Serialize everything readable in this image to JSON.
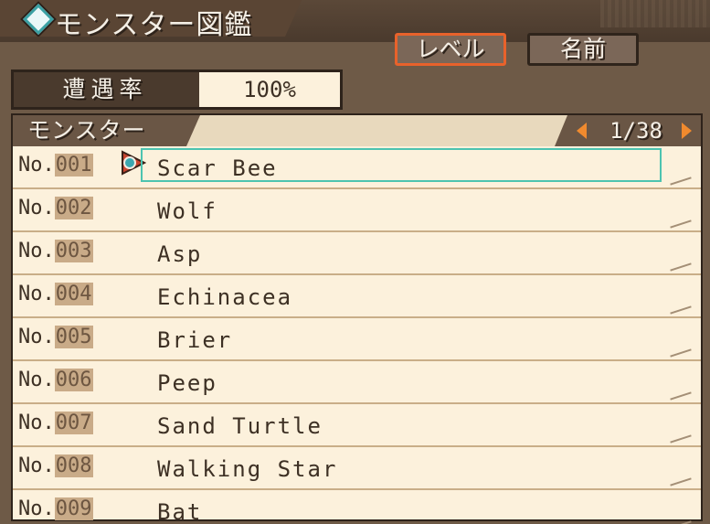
{
  "title": "モンスター図鑑",
  "sort_buttons": {
    "level": "レベル",
    "name": "名前"
  },
  "encounter": {
    "label": "遭遇率",
    "value": "100%"
  },
  "list_header": "モンスター",
  "pager": {
    "current": "1/38"
  },
  "monsters": [
    {
      "no_prefix": "No.",
      "no": "001",
      "name": "Scar Bee"
    },
    {
      "no_prefix": "No.",
      "no": "002",
      "name": "Wolf"
    },
    {
      "no_prefix": "No.",
      "no": "003",
      "name": "Asp"
    },
    {
      "no_prefix": "No.",
      "no": "004",
      "name": "Echinacea"
    },
    {
      "no_prefix": "No.",
      "no": "005",
      "name": "Brier"
    },
    {
      "no_prefix": "No.",
      "no": "006",
      "name": "Peep"
    },
    {
      "no_prefix": "No.",
      "no": "007",
      "name": "Sand Turtle"
    },
    {
      "no_prefix": "No.",
      "no": "008",
      "name": "Walking Star"
    },
    {
      "no_prefix": "No.",
      "no": "009",
      "name": "Bat"
    }
  ],
  "colors": {
    "selection_border": "#4cc3b0",
    "active_sort_border": "#e8622b",
    "pager_arrow": "#f08a2e"
  },
  "icons": {
    "title_marker": "diamond-icon",
    "cursor": "pointer-cursor-icon",
    "prev": "triangle-left-icon",
    "next": "triangle-right-icon"
  }
}
